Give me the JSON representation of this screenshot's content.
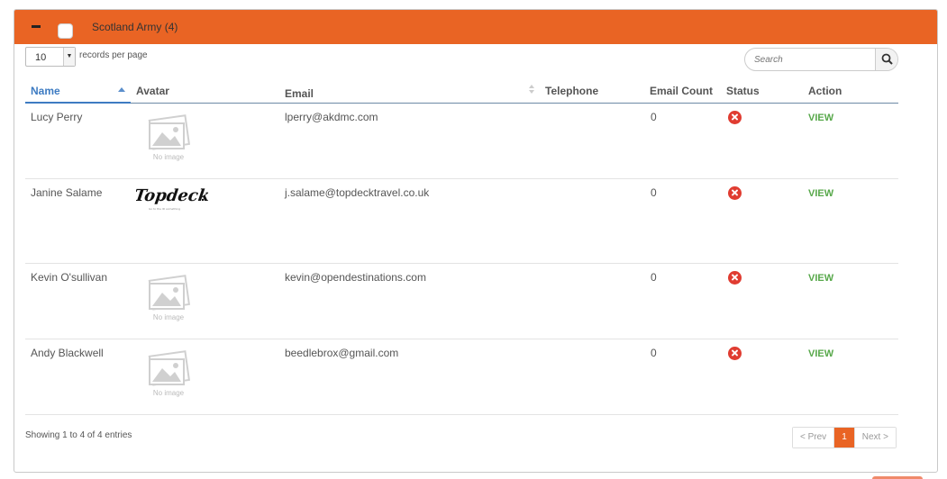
{
  "group": {
    "title": "Scotland Army (4)"
  },
  "length": {
    "value": "10",
    "label": "records per page"
  },
  "search": {
    "placeholder": "Search"
  },
  "columns": {
    "name": "Name",
    "avatar": "Avatar",
    "email": "Email",
    "telephone": "Telephone",
    "email_count": "Email Count",
    "status": "Status",
    "action": "Action"
  },
  "no_image_label": "No image",
  "rows": [
    {
      "name": "Lucy Perry",
      "avatar": "no-image",
      "email": "lperry@akdmc.com",
      "telephone": "",
      "email_count": "0",
      "status": "inactive",
      "action": "VIEW"
    },
    {
      "name": "Janine Salame",
      "avatar": "topdeck-logo",
      "email": "j.salame@topdecktravel.co.uk",
      "telephone": "",
      "email_count": "0",
      "status": "inactive",
      "action": "VIEW"
    },
    {
      "name": "Kevin O'sullivan",
      "avatar": "no-image",
      "email": "kevin@opendestinations.com",
      "telephone": "",
      "email_count": "0",
      "status": "inactive",
      "action": "VIEW"
    },
    {
      "name": "Andy Blackwell",
      "avatar": "no-image",
      "email": "beedlebrox@gmail.com",
      "telephone": "",
      "email_count": "0",
      "status": "inactive",
      "action": "VIEW"
    }
  ],
  "logo_text": "Topdeck",
  "logo_tagline": "Go to the ID something",
  "footer": {
    "info": "Showing 1 to 4 of 4 entries"
  },
  "pagination": {
    "prev": "< Prev",
    "current": "1",
    "next": "Next >"
  },
  "colors": {
    "accent": "#e96424",
    "link": "#3d7bc2",
    "view": "#57a84a",
    "status_error": "#e03c31"
  }
}
